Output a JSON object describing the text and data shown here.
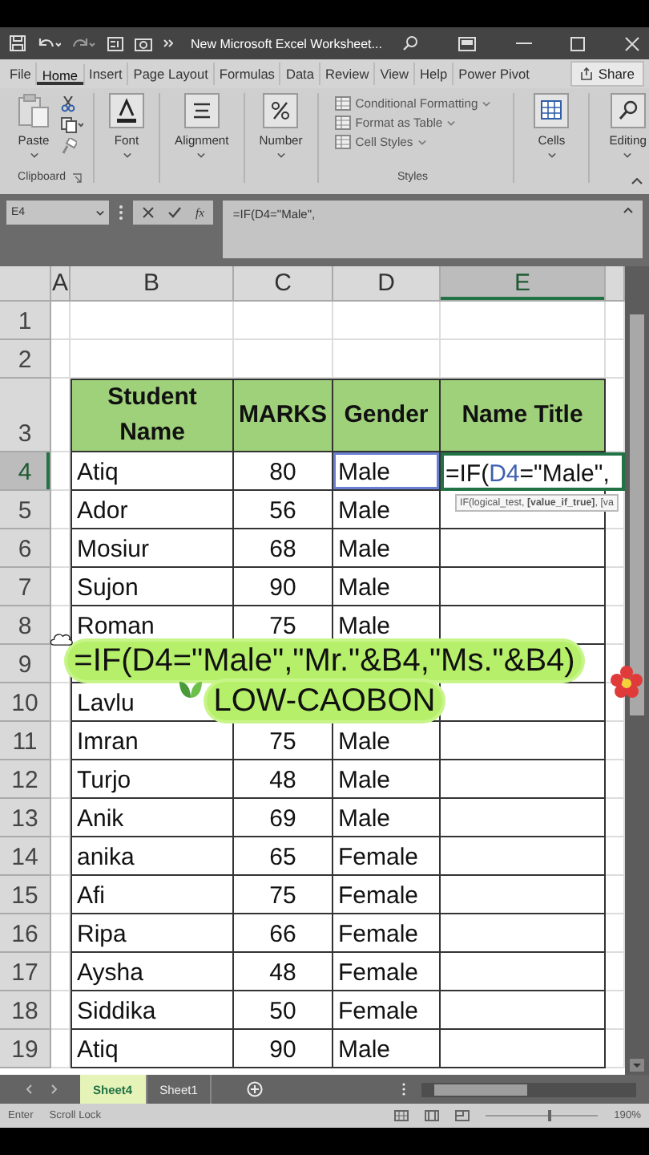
{
  "title_bar": {
    "title": "New Microsoft Excel Worksheet..."
  },
  "menu_tabs": [
    {
      "label": "File",
      "selected": false
    },
    {
      "label": "Home",
      "selected": true
    },
    {
      "label": "Insert",
      "selected": false
    },
    {
      "label": "Page Layout",
      "selected": false
    },
    {
      "label": "Formulas",
      "selected": false
    },
    {
      "label": "Data",
      "selected": false
    },
    {
      "label": "Review",
      "selected": false
    },
    {
      "label": "View",
      "selected": false
    },
    {
      "label": "Help",
      "selected": false
    },
    {
      "label": "Power Pivot",
      "selected": false
    }
  ],
  "share_button": "Share",
  "ribbon": {
    "groups": [
      {
        "kind": "clipboard",
        "button": "Paste",
        "label": "Clipboard"
      },
      {
        "kind": "font",
        "button": "Font"
      },
      {
        "kind": "alignment",
        "button": "Alignment"
      },
      {
        "kind": "number",
        "button": "Number"
      },
      {
        "kind": "styles",
        "items": [
          "Conditional Formatting",
          "Format as Table",
          "Cell Styles"
        ],
        "label": "Styles"
      },
      {
        "kind": "cells",
        "button": "Cells"
      },
      {
        "kind": "editing",
        "button": "Editing"
      }
    ]
  },
  "formula_bar": {
    "name_box": "E4",
    "function_label": "fx",
    "formula": "=IF(D4=\"Male\","
  },
  "columns": [
    {
      "label": "A",
      "selected": false
    },
    {
      "label": "B",
      "selected": false
    },
    {
      "label": "C",
      "selected": false
    },
    {
      "label": "D",
      "selected": false
    },
    {
      "label": "E",
      "selected": true
    }
  ],
  "rows": [
    {
      "number": "1",
      "kind": "blank",
      "selected": false
    },
    {
      "number": "2",
      "kind": "blank",
      "selected": false
    },
    {
      "number": "3",
      "kind": "header",
      "selected": false,
      "headings": [
        "Student Name",
        "MARKS",
        "Gender",
        "Name Title"
      ]
    },
    {
      "number": "4",
      "kind": "data",
      "selected": true,
      "name": "Atiq",
      "marks": "80",
      "gender": "Male",
      "referenced": true,
      "active_cell": [
        {
          "text": "=IF("
        },
        {
          "text": "D4",
          "color": "#3f5fb0"
        },
        {
          "text": "=\"Male\","
        }
      ],
      "tooltip": "IF(logical_test, **[value_if_true]**, [va"
    },
    {
      "number": "5",
      "kind": "data",
      "selected": false,
      "name": "Ador",
      "marks": "56",
      "gender": "Male",
      "referenced": false
    },
    {
      "number": "6",
      "kind": "data",
      "selected": false,
      "name": "Mosiur",
      "marks": "68",
      "gender": "Male",
      "referenced": false
    },
    {
      "number": "7",
      "kind": "data",
      "selected": false,
      "name": "Sujon",
      "marks": "90",
      "gender": "Male",
      "referenced": false
    },
    {
      "number": "8",
      "kind": "data",
      "selected": false,
      "name": "Roman",
      "marks": "75",
      "gender": "Male",
      "referenced": false
    },
    {
      "number": "9",
      "kind": "data",
      "selected": false
    },
    {
      "number": "10",
      "kind": "data",
      "selected": false,
      "name": "Lavlu"
    },
    {
      "number": "11",
      "kind": "data",
      "selected": false,
      "name": "Imran",
      "marks": "75",
      "gender": "Male",
      "referenced": false
    },
    {
      "number": "12",
      "kind": "data",
      "selected": false,
      "name": "Turjo",
      "marks": "48",
      "gender": "Male",
      "referenced": false
    },
    {
      "number": "13",
      "kind": "data",
      "selected": false,
      "name": "Anik",
      "marks": "69",
      "gender": "Male",
      "referenced": false
    },
    {
      "number": "14",
      "kind": "data",
      "selected": false,
      "name": "anika",
      "marks": "65",
      "gender": "Female",
      "referenced": false
    },
    {
      "number": "15",
      "kind": "data",
      "selected": false,
      "name": "Afi",
      "marks": "75",
      "gender": "Female",
      "referenced": false
    },
    {
      "number": "16",
      "kind": "data",
      "selected": false,
      "name": "Ripa",
      "marks": "66",
      "gender": "Female",
      "referenced": false
    },
    {
      "number": "17",
      "kind": "data",
      "selected": false,
      "name": "Aysha",
      "marks": "48",
      "gender": "Female",
      "referenced": false
    },
    {
      "number": "18",
      "kind": "data",
      "selected": false,
      "name": "Siddika",
      "marks": "50",
      "gender": "Female",
      "referenced": false
    },
    {
      "number": "19",
      "kind": "data",
      "selected": false,
      "name": "Atiq",
      "marks": "90",
      "gender": "Male",
      "referenced": false
    }
  ],
  "sheet_tabs": [
    {
      "label": "Sheet4",
      "selected": true
    },
    {
      "label": "Sheet1",
      "selected": false
    }
  ],
  "status_bar": {
    "mode": "Enter",
    "scroll_lock": "Scroll Lock",
    "zoom": "190%",
    "zoom_slider": {
      "level": 0.55
    }
  },
  "caption": {
    "lines": [
      "=IF(D4=\"Male\",\"Mr.\"&B4,\"Ms.\"&B4)",
      "LOW-CAOBON"
    ]
  }
}
